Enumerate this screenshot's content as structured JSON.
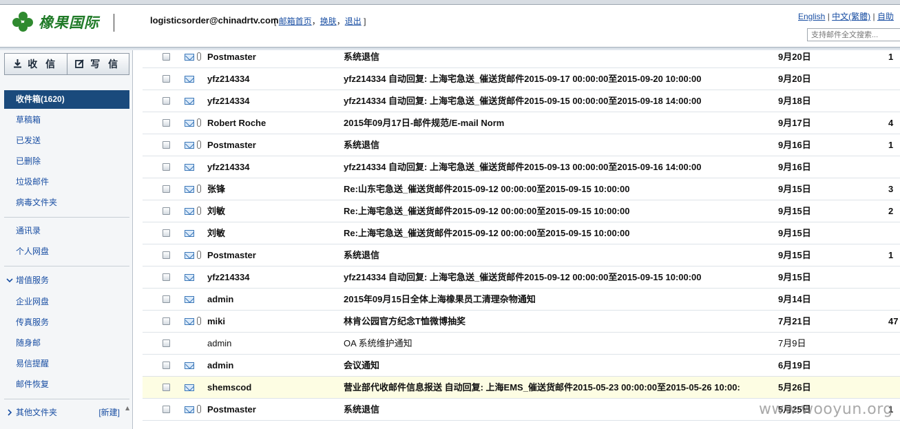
{
  "header": {
    "logo_text": "橡果国际",
    "user_email": "logisticsorder@chinadrtv.com",
    "links": [
      "邮箱首页",
      "换肤",
      "退出"
    ],
    "languages": [
      "English",
      "中文(繁體)",
      "自助"
    ],
    "search_placeholder": "支持邮件全文搜索..."
  },
  "sidebar": {
    "receive_label": "收 信",
    "compose_label": "写 信",
    "folders": [
      {
        "label": "收件箱(1620)",
        "active": true
      },
      {
        "label": "草稿箱"
      },
      {
        "label": "已发送"
      },
      {
        "label": "已删除"
      },
      {
        "label": "垃圾邮件"
      },
      {
        "label": "病毒文件夹"
      }
    ],
    "tools": [
      "通讯录",
      "个人网盘"
    ],
    "value_added": {
      "label": "增值服务",
      "items": [
        "企业网盘",
        "传真服务",
        "随身邮",
        "易信提醒",
        "邮件恢复"
      ]
    },
    "other_folders": {
      "label": "其他文件夹",
      "new_label": "[新建]"
    }
  },
  "mails": [
    {
      "sender": "Postmaster",
      "subject": "系统退信",
      "date": "9月20日",
      "size": "1",
      "unread": true,
      "attachment": true,
      "icon": "envelope"
    },
    {
      "sender": "yfz214334",
      "subject": "yfz214334 自动回复: 上海宅急送_催送货邮件2015-09-17 00:00:00至2015-09-20 10:00:00",
      "date": "9月20日",
      "size": "",
      "unread": true,
      "attachment": false,
      "icon": "envelope"
    },
    {
      "sender": "yfz214334",
      "subject": "yfz214334 自动回复: 上海宅急送_催送货邮件2015-09-15 00:00:00至2015-09-18 14:00:00",
      "date": "9月18日",
      "size": "",
      "unread": true,
      "attachment": false,
      "icon": "envelope"
    },
    {
      "sender": "Robert Roche",
      "subject": "2015年09月17日-邮件规范/E-mail Norm",
      "date": "9月17日",
      "size": "4",
      "unread": true,
      "attachment": true,
      "icon": "envelope"
    },
    {
      "sender": "Postmaster",
      "subject": "系统退信",
      "date": "9月16日",
      "size": "1",
      "unread": true,
      "attachment": true,
      "icon": "envelope"
    },
    {
      "sender": "yfz214334",
      "subject": "yfz214334 自动回复: 上海宅急送_催送货邮件2015-09-13 00:00:00至2015-09-16 14:00:00",
      "date": "9月16日",
      "size": "",
      "unread": true,
      "attachment": false,
      "icon": "envelope"
    },
    {
      "sender": "张锋",
      "subject": "Re:山东宅急送_催送货邮件2015-09-12 00:00:00至2015-09-15 10:00:00",
      "date": "9月15日",
      "size": "3",
      "unread": true,
      "attachment": true,
      "icon": "envelope"
    },
    {
      "sender": "刘敏",
      "subject": "Re:上海宅急送_催送货邮件2015-09-12 00:00:00至2015-09-15 10:00:00",
      "date": "9月15日",
      "size": "2",
      "unread": true,
      "attachment": true,
      "icon": "envelope"
    },
    {
      "sender": "刘敏",
      "subject": "Re:上海宅急送_催送货邮件2015-09-12 00:00:00至2015-09-15 10:00:00",
      "date": "9月15日",
      "size": "",
      "unread": true,
      "attachment": false,
      "icon": "envelope"
    },
    {
      "sender": "Postmaster",
      "subject": "系统退信",
      "date": "9月15日",
      "size": "1",
      "unread": true,
      "attachment": true,
      "icon": "envelope"
    },
    {
      "sender": "yfz214334",
      "subject": "yfz214334 自动回复: 上海宅急送_催送货邮件2015-09-12 00:00:00至2015-09-15 10:00:00",
      "date": "9月15日",
      "size": "",
      "unread": true,
      "attachment": false,
      "icon": "envelope"
    },
    {
      "sender": "admin",
      "subject": "2015年09月15日全体上海橡果员工清理杂物通知",
      "date": "9月14日",
      "size": "",
      "unread": true,
      "attachment": false,
      "icon": "envelope"
    },
    {
      "sender": "miki",
      "subject": "林肯公园官方纪念T恤微博抽奖",
      "date": "7月21日",
      "size": "47",
      "unread": true,
      "attachment": true,
      "icon": "envelope"
    },
    {
      "sender": "admin",
      "subject": "OA 系统维护通知",
      "date": "7月9日",
      "size": "",
      "unread": false,
      "attachment": false,
      "icon": "none"
    },
    {
      "sender": "admin",
      "subject": "会议通知",
      "date": "6月19日",
      "size": "",
      "unread": true,
      "attachment": false,
      "icon": "envelope"
    },
    {
      "sender": "shemscod",
      "subject": "营业部代收邮件信息报送 自动回复: 上海EMS_催送货邮件2015-05-23 00:00:00至2015-05-26 10:00:",
      "date": "5月26日",
      "size": "",
      "unread": true,
      "attachment": false,
      "icon": "envelope",
      "highlight": true
    },
    {
      "sender": "Postmaster",
      "subject": "系统退信",
      "date": "5月25日",
      "size": "1",
      "unread": true,
      "attachment": true,
      "icon": "envelope"
    }
  ],
  "watermark": "www.wooyun.org"
}
